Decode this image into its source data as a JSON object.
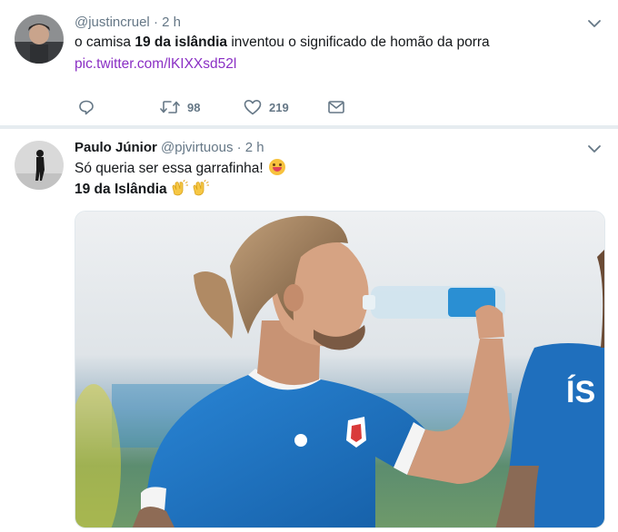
{
  "tweets": [
    {
      "display_name": "",
      "handle": "@justincruel",
      "dot": "·",
      "time": "2 h",
      "text_before": "o camisa ",
      "text_bold": "19 da islândia",
      "text_after": " inventou o significado de homão da porra",
      "link": "pic.twitter.com/lKIXXsd52l",
      "retweet_count": "98",
      "like_count": "219"
    },
    {
      "display_name": "Paulo Júnior",
      "handle": "@pjvirtuous",
      "dot": "·",
      "time": "2 h",
      "line1": "Só queria ser essa garrafinha!",
      "line2": "19 da Islândia",
      "line1_emoji": "smiling-face-icon",
      "line2_emoji": "clapping-hands-icon",
      "media_description_icon": "photo-player-drinking-water"
    }
  ],
  "colors": {
    "link": "#8a2fc4",
    "secondary_text": "#657786",
    "jersey_blue": "#1f78c8",
    "separator": "#e6ecf0"
  }
}
